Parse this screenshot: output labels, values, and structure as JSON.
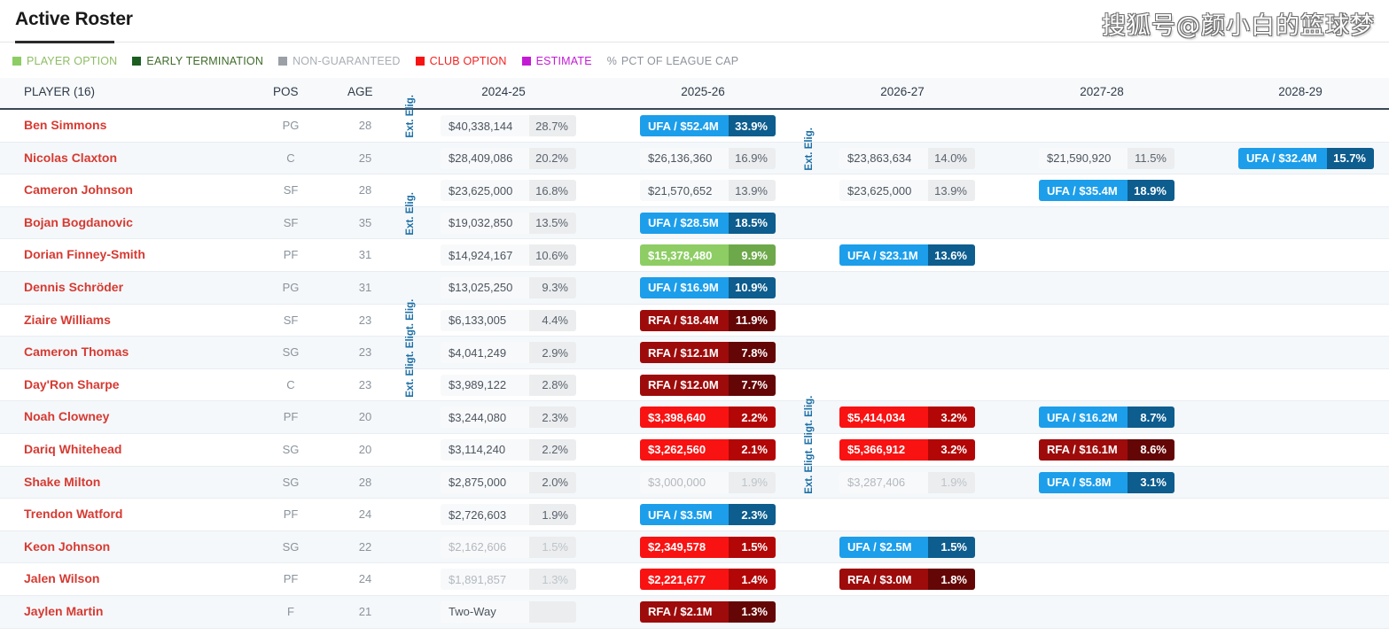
{
  "header": {
    "title": "Active Roster",
    "watermark": "搜狐号@颜小白的篮球梦"
  },
  "legend": {
    "items": [
      {
        "label": "PLAYER OPTION",
        "color": "#8dcd64",
        "text_color": "#8dbd63",
        "icon": "square-swatch-icon"
      },
      {
        "label": "EARLY TERMINATION",
        "color": "#1b5e20",
        "text_color": "#3f6b2a",
        "icon": "square-swatch-icon"
      },
      {
        "label": "NON-GUARANTEED",
        "color": "#9aa0a6",
        "text_color": "#a8aeb4",
        "icon": "square-swatch-icon"
      },
      {
        "label": "CLUB OPTION",
        "color": "#f91212",
        "text_color": "#f42020",
        "icon": "square-swatch-icon"
      },
      {
        "label": "ESTIMATE",
        "color": "#c41ad6",
        "text_color": "#c41ad6",
        "icon": "square-swatch-icon"
      }
    ],
    "pct_symbol": "%",
    "pct_label": "PCT OF LEAGUE CAP",
    "pct_text_color": "#8d949c"
  },
  "columns": {
    "player": "PLAYER (16)",
    "pos": "POS",
    "age": "AGE",
    "years": [
      "2024-25",
      "2025-26",
      "2026-27",
      "2027-28",
      "2028-29"
    ]
  },
  "ext_elig_label": "Ext. Eligt. Eligt. Elig.",
  "ext_elig_label_short": "Ext. Elig.",
  "rows": [
    {
      "name": "Ben Simmons",
      "pos": "PG",
      "age": "28",
      "cells": [
        {
          "value": "$40,338,144",
          "pct": "28.7%",
          "style": "plain"
        },
        {
          "value": "UFA / $52.4M",
          "pct": "33.9%",
          "style": "ufa"
        },
        null,
        null,
        null
      ]
    },
    {
      "name": "Nicolas Claxton",
      "pos": "C",
      "age": "25",
      "cells": [
        {
          "value": "$28,409,086",
          "pct": "20.2%",
          "style": "plain"
        },
        {
          "value": "$26,136,360",
          "pct": "16.9%",
          "style": "plain"
        },
        {
          "value": "$23,863,634",
          "pct": "14.0%",
          "style": "plain"
        },
        {
          "value": "$21,590,920",
          "pct": "11.5%",
          "style": "plain"
        },
        {
          "value": "UFA / $32.4M",
          "pct": "15.7%",
          "style": "ufa"
        }
      ]
    },
    {
      "name": "Cameron Johnson",
      "pos": "SF",
      "age": "28",
      "cells": [
        {
          "value": "$23,625,000",
          "pct": "16.8%",
          "style": "plain"
        },
        {
          "value": "$21,570,652",
          "pct": "13.9%",
          "style": "plain"
        },
        {
          "value": "$23,625,000",
          "pct": "13.9%",
          "style": "plain"
        },
        {
          "value": "UFA / $35.4M",
          "pct": "18.9%",
          "style": "ufa"
        },
        null
      ]
    },
    {
      "name": "Bojan Bogdanovic",
      "pos": "SF",
      "age": "35",
      "cells": [
        {
          "value": "$19,032,850",
          "pct": "13.5%",
          "style": "plain"
        },
        {
          "value": "UFA / $28.5M",
          "pct": "18.5%",
          "style": "ufa"
        },
        null,
        null,
        null
      ]
    },
    {
      "name": "Dorian Finney-Smith",
      "pos": "PF",
      "age": "31",
      "cells": [
        {
          "value": "$14,924,167",
          "pct": "10.6%",
          "style": "plain"
        },
        {
          "value": "$15,378,480",
          "pct": "9.9%",
          "style": "playeropt"
        },
        {
          "value": "UFA / $23.1M",
          "pct": "13.6%",
          "style": "ufa"
        },
        null,
        null
      ]
    },
    {
      "name": "Dennis Schröder",
      "pos": "PG",
      "age": "31",
      "cells": [
        {
          "value": "$13,025,250",
          "pct": "9.3%",
          "style": "plain"
        },
        {
          "value": "UFA / $16.9M",
          "pct": "10.9%",
          "style": "ufa"
        },
        null,
        null,
        null
      ]
    },
    {
      "name": "Ziaire Williams",
      "pos": "SF",
      "age": "23",
      "cells": [
        {
          "value": "$6,133,005",
          "pct": "4.4%",
          "style": "plain"
        },
        {
          "value": "RFA / $18.4M",
          "pct": "11.9%",
          "style": "rfa"
        },
        null,
        null,
        null
      ]
    },
    {
      "name": "Cameron Thomas",
      "pos": "SG",
      "age": "23",
      "cells": [
        {
          "value": "$4,041,249",
          "pct": "2.9%",
          "style": "plain"
        },
        {
          "value": "RFA / $12.1M",
          "pct": "7.8%",
          "style": "rfa"
        },
        null,
        null,
        null
      ]
    },
    {
      "name": "Day'Ron Sharpe",
      "pos": "C",
      "age": "23",
      "cells": [
        {
          "value": "$3,989,122",
          "pct": "2.8%",
          "style": "plain"
        },
        {
          "value": "RFA / $12.0M",
          "pct": "7.7%",
          "style": "rfa"
        },
        null,
        null,
        null
      ]
    },
    {
      "name": "Noah Clowney",
      "pos": "PF",
      "age": "20",
      "cells": [
        {
          "value": "$3,244,080",
          "pct": "2.3%",
          "style": "plain"
        },
        {
          "value": "$3,398,640",
          "pct": "2.2%",
          "style": "club"
        },
        {
          "value": "$5,414,034",
          "pct": "3.2%",
          "style": "club"
        },
        {
          "value": "UFA / $16.2M",
          "pct": "8.7%",
          "style": "ufa"
        },
        null
      ]
    },
    {
      "name": "Dariq Whitehead",
      "pos": "SG",
      "age": "20",
      "cells": [
        {
          "value": "$3,114,240",
          "pct": "2.2%",
          "style": "plain"
        },
        {
          "value": "$3,262,560",
          "pct": "2.1%",
          "style": "club"
        },
        {
          "value": "$5,366,912",
          "pct": "3.2%",
          "style": "club"
        },
        {
          "value": "RFA / $16.1M",
          "pct": "8.6%",
          "style": "rfa"
        },
        null
      ]
    },
    {
      "name": "Shake Milton",
      "pos": "SG",
      "age": "28",
      "cells": [
        {
          "value": "$2,875,000",
          "pct": "2.0%",
          "style": "plain"
        },
        {
          "value": "$3,000,000",
          "pct": "1.9%",
          "style": "nonguar"
        },
        {
          "value": "$3,287,406",
          "pct": "1.9%",
          "style": "nonguar"
        },
        {
          "value": "UFA / $5.8M",
          "pct": "3.1%",
          "style": "ufa"
        },
        null
      ]
    },
    {
      "name": "Trendon Watford",
      "pos": "PF",
      "age": "24",
      "cells": [
        {
          "value": "$2,726,603",
          "pct": "1.9%",
          "style": "plain"
        },
        {
          "value": "UFA / $3.5M",
          "pct": "2.3%",
          "style": "ufa"
        },
        null,
        null,
        null
      ]
    },
    {
      "name": "Keon Johnson",
      "pos": "SG",
      "age": "22",
      "cells": [
        {
          "value": "$2,162,606",
          "pct": "1.5%",
          "style": "nonguar"
        },
        {
          "value": "$2,349,578",
          "pct": "1.5%",
          "style": "club"
        },
        {
          "value": "UFA / $2.5M",
          "pct": "1.5%",
          "style": "ufa"
        },
        null,
        null
      ]
    },
    {
      "name": "Jalen Wilson",
      "pos": "PF",
      "age": "24",
      "cells": [
        {
          "value": "$1,891,857",
          "pct": "1.3%",
          "style": "nonguar"
        },
        {
          "value": "$2,221,677",
          "pct": "1.4%",
          "style": "club"
        },
        {
          "value": "RFA / $3.0M",
          "pct": "1.8%",
          "style": "rfa"
        },
        null,
        null
      ]
    },
    {
      "name": "Jaylen Martin",
      "pos": "F",
      "age": "21",
      "cells": [
        {
          "value": "Two-Way",
          "pct": "",
          "style": "twoway"
        },
        {
          "value": "RFA / $2.1M",
          "pct": "1.3%",
          "style": "rfa"
        },
        null,
        null,
        null
      ]
    }
  ],
  "ext_elig_markers": [
    {
      "col": 0,
      "row_start": 0,
      "span": 1,
      "label": "Ext. Elig."
    },
    {
      "col": 0,
      "row_start": 3,
      "span": 1,
      "label": "Ext. Elig."
    },
    {
      "col": 0,
      "row_start": 6,
      "span": 3,
      "label": "Ext. Eligt. Eligt. Elig."
    },
    {
      "col": 1,
      "row_start": 1,
      "span": 1,
      "label": "Ext. Elig."
    },
    {
      "col": 1,
      "row_start": 9,
      "span": 3,
      "label": "Ext. Eligt. Eligt. Elig."
    }
  ]
}
